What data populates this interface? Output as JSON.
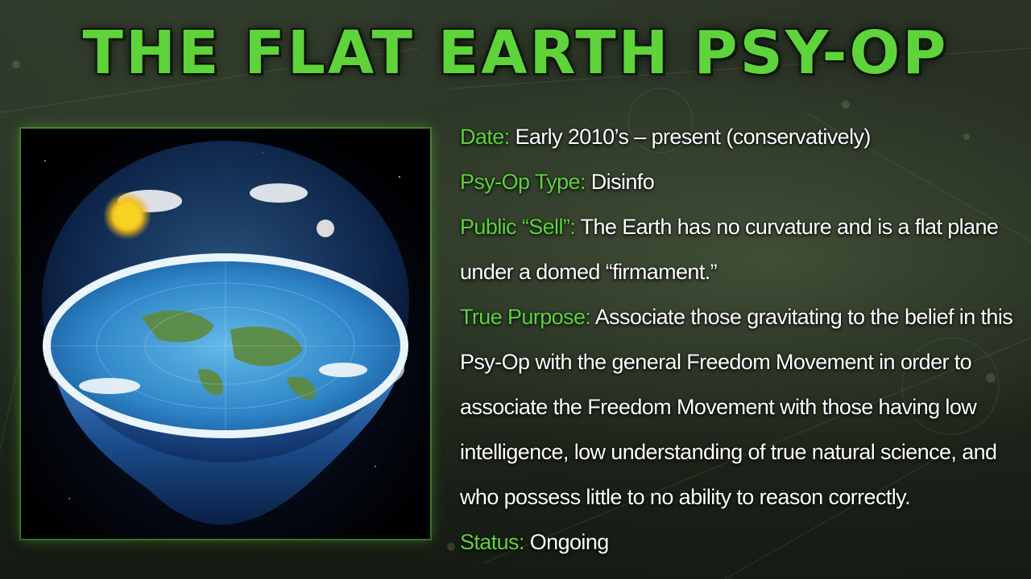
{
  "slide": {
    "title": "THE FLAT EARTH PSY-OP"
  },
  "image": {
    "icon": "flat-earth-dome-illustration"
  },
  "info": {
    "date_label": "Date:",
    "date_value": "Early 2010’s – present (conservatively)",
    "type_label": "Psy-Op Type:",
    "type_value": "Disinfo",
    "sell_label": "Public “Sell”:",
    "sell_value": "The Earth has no curvature and is a flat plane under a domed “firmament.”",
    "purpose_label": "True Purpose:",
    "purpose_value": "Associate those gravitating to the belief in this Psy-Op with the general Freedom Movement in order to associate the Freedom Movement with those having low intelligence, low understanding of true natural science, and who possess little to no ability to reason correctly.",
    "status_label": "Status:",
    "status_value": "Ongoing"
  },
  "colors": {
    "accent": "#5ed43a",
    "text": "#ffffff"
  }
}
